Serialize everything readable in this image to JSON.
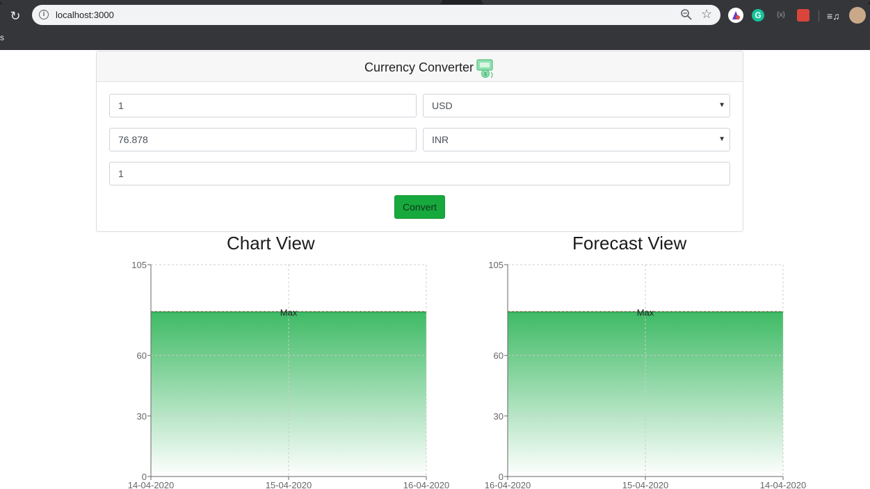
{
  "browser": {
    "url": "localhost:3000",
    "bookmark_fragment": "s"
  },
  "converter": {
    "title": "Currency Converter",
    "amount_value": "1",
    "from_currency": "USD",
    "converted_value": "76.878",
    "to_currency": "INR",
    "third_value": "1",
    "convert_label": "Convert"
  },
  "charts": {
    "chart_view_title": "Chart View",
    "forecast_view_title": "Forecast View"
  },
  "colors": {
    "accent_green": "#17a93d",
    "area_green": "#3dba64"
  },
  "chart_data": [
    {
      "type": "area",
      "title": "Chart View",
      "x": [
        "14-04-2020",
        "15-04-2020",
        "16-04-2020"
      ],
      "series": [
        {
          "values": [
            81.8,
            81.8,
            81.8
          ]
        }
      ],
      "yticks": [
        "0",
        "30",
        "60",
        "105"
      ],
      "ylim": [
        0,
        105
      ],
      "reference_line": {
        "label": "Max",
        "value": 81.8
      },
      "grid": true
    },
    {
      "type": "area",
      "title": "Forecast View",
      "x": [
        "16-04-2020",
        "15-04-2020",
        "14-04-2020"
      ],
      "series": [
        {
          "values": [
            81.8,
            81.8,
            81.8
          ]
        }
      ],
      "yticks": [
        "0",
        "30",
        "60",
        "105"
      ],
      "ylim": [
        0,
        105
      ],
      "reference_line": {
        "label": "Max",
        "value": 81.8
      },
      "grid": true
    }
  ]
}
